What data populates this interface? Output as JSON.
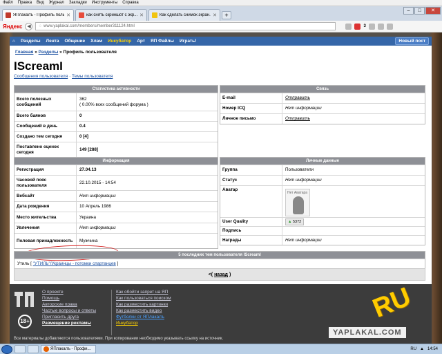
{
  "browser": {
    "menu": [
      "Файл",
      "Правка",
      "Вид",
      "Журнал",
      "Закладки",
      "Инструменты",
      "Справка"
    ],
    "tabs": [
      {
        "label": "ЯПлакалъ - Профиль польз...",
        "active": true
      },
      {
        "label": "как снять скриншот с экр...",
        "active": false
      },
      {
        "label": "Как сделать снимок экран...",
        "active": false
      }
    ],
    "address_brand": "Яндекс",
    "url": "www.yaplakal.com/members/member311124.html",
    "ext_count": "3"
  },
  "site": {
    "nav": [
      "Разделы",
      "Лента",
      "Общение",
      "Хлам",
      "Инкубатор",
      "Арт",
      "ЯП Файлы",
      "Играть!"
    ],
    "new_post": "Новый пост",
    "breadcrumb": {
      "home": "Главная",
      "section": "Разделы",
      "current": "Профиль пользователя"
    },
    "username": "IScreamI",
    "user_links": {
      "posts": "Сообщения пользователя",
      "sep": " · ",
      "themes": "Темы пользователя"
    }
  },
  "stats": {
    "header": "Статистика активности",
    "rows": [
      {
        "k": "Всего полезных сообщений",
        "v": "362",
        "v2": "( 0.00% всех сообщений форума )"
      },
      {
        "k": "Всего баянов",
        "v": "0"
      },
      {
        "k": "Сообщений в день",
        "v": "0.4"
      },
      {
        "k": "Создано тем сегодня",
        "v": "0 [4]"
      },
      {
        "k": "Поставлено оценок сегодня",
        "v": "149 [288]"
      }
    ]
  },
  "contact": {
    "header": "Связь",
    "rows": [
      {
        "k": "E-mail",
        "v": "Отправить"
      },
      {
        "k": "Номер ICQ",
        "v": "Нет информации"
      },
      {
        "k": "Личное письмо",
        "v": "Отправить"
      }
    ]
  },
  "info": {
    "header": "Информация",
    "rows": [
      {
        "k": "Регистрация",
        "v": "27.04.13"
      },
      {
        "k": "Часовой пояс пользователя",
        "v": "22.10.2015 - 14:54"
      },
      {
        "k": "Вебсайт",
        "v": "Нет информации"
      },
      {
        "k": "Дата рождения",
        "v": "10 Апрель 1986"
      },
      {
        "k": "Место жительства",
        "v": "Украина"
      },
      {
        "k": "Увлечения",
        "v": "Нет информации"
      },
      {
        "k": "Половая принадлежность",
        "v": "Мужчина"
      }
    ]
  },
  "personal": {
    "header": "Личные данные",
    "rows": [
      {
        "k": "Группа",
        "v": "Пользователи"
      },
      {
        "k": "Статус",
        "v": "Нет информации"
      },
      {
        "k": "Аватар",
        "v": "Нет Аватара"
      },
      {
        "k": "User Quality",
        "v": "5372"
      },
      {
        "k": "Подпись",
        "v": ""
      },
      {
        "k": "Награды",
        "v": "Нет информации"
      }
    ]
  },
  "last_themes": {
    "header": "5 последних тем пользователя IScreamI",
    "prefix": "Утиль [",
    "link": "\"УТИЛЬ\"/Украинцы - потомки спартанцев",
    "suffix": "]"
  },
  "pager": {
    "left": "<(",
    "label": "назад",
    "right": ")"
  },
  "footer": {
    "age": "18+",
    "col1": [
      "О проекте",
      "Помощь",
      "Авторские права",
      "Частые вопросы и ответы",
      "Пригласить друга",
      "Размещение рекламы"
    ],
    "col2": [
      "Как обойти запрет на ЯП",
      "Как пользоваться поиском",
      "Как разместить картинки",
      "Как разместить видео",
      "Футболки от ЯПлакалъ",
      "Инкубатор"
    ],
    "note": "Все материалы добавляются пользователями. При копировании необходимо указывать ссылку на источник.",
    "brand_ru": "RU",
    "brand_site": "YAPLAKAL.COM"
  },
  "taskbar": {
    "app": "ЯПлакалъ - Профи...",
    "lang": "RU",
    "time": "14:54"
  }
}
